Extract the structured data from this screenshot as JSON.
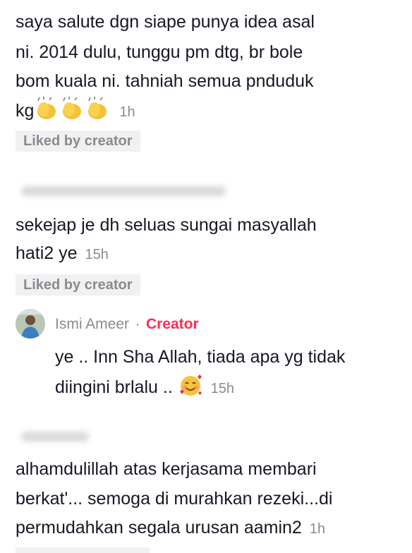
{
  "comment1": {
    "lines": [
      "saya salute dgn siape punya idea asal",
      "ni. 2014 dulu, tunggu pm dtg, br bole",
      "bom kuala ni. tahniah semua pnduduk",
      "kg"
    ],
    "emojis": [
      "clapping-hands",
      "clapping-hands",
      "clapping-hands"
    ],
    "time": "1h",
    "liked": "Liked by creator"
  },
  "comment2": {
    "lines": [
      "sekejap je dh seluas sungai masyallah",
      "hati2 ye"
    ],
    "time": "15h",
    "liked": "Liked by creator"
  },
  "reply": {
    "author": "Ismi Ameer",
    "separator": "·",
    "badge": "Creator",
    "lines": [
      "ye .. Inn Sha Allah, tiada apa yg tidak",
      "diingini brlalu .."
    ],
    "emoji": "smiling-face-with-hearts",
    "time": "15h"
  },
  "comment3": {
    "lines": [
      "alhamdulillah atas kerjasama membari",
      "berkat'... semoga di murahkan rezeki...di",
      "permudahkan segala urusan aamin2"
    ],
    "time": "1h"
  },
  "colors": {
    "text": "#161823",
    "muted": "#8a8b91",
    "accent": "#fe2c55",
    "liked_bg": "#f1f1f2"
  }
}
